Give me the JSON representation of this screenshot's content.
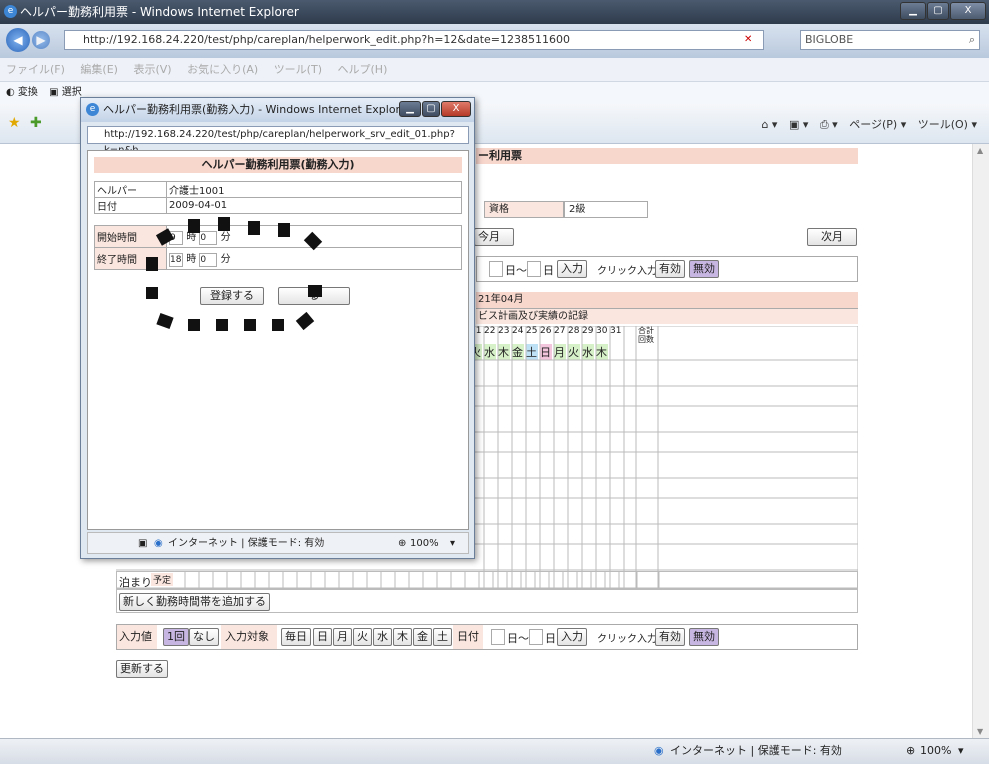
{
  "window": {
    "title": "ヘルパー勤務利用票 - Windows Internet Explorer",
    "min": "▁",
    "max": "▢",
    "close": "X"
  },
  "browser": {
    "address": "http://192.168.24.220/test/php/careplan/helperwork_edit.php?h=12&date=1238511600",
    "search_provider": "BIGLOBE",
    "back": "◀",
    "forward": "▶"
  },
  "menu": [
    "ファイル(F)",
    "編集(E)",
    "表示(V)",
    "お気に入り(A)",
    "ツール(T)",
    "ヘルプ(H)"
  ],
  "favbar": {
    "convert": "変換",
    "select": "選択"
  },
  "cmdbar": {
    "home": "⌂",
    "feeds": "▣",
    "print": "⎙",
    "page": "ページ(P)",
    "tools": "ツール(O)"
  },
  "main": {
    "header": "ー利用票",
    "qualification_label": "資格",
    "qualification_value": "2級",
    "this_month": "今月",
    "next_month": "次月",
    "day_suffix1": "日～",
    "day_suffix2": "日",
    "input_btn": "入力",
    "click_input": "クリック入力",
    "valid": "有効",
    "invalid": "無効",
    "year_month": "21年04月",
    "plan_record": "ビス計画及び実績の記録",
    "days": [
      "21",
      "22",
      "23",
      "24",
      "25",
      "26",
      "27",
      "28",
      "29",
      "30",
      "31"
    ],
    "weekdays": [
      "火",
      "水",
      "木",
      "金",
      "土",
      "日",
      "月",
      "火",
      "水",
      "木",
      ""
    ],
    "total_label": "合計回数",
    "stay_label": "泊まり",
    "plan_label": "予定",
    "add_row_btn": "新しく勤務時間帯を追加する",
    "input_value_label": "入力値",
    "once": "1回",
    "none": "なし",
    "input_target": "入力対象",
    "everyday": "毎日",
    "wd": [
      "日",
      "月",
      "火",
      "水",
      "木",
      "金",
      "土"
    ],
    "date_label": "日付",
    "update_btn": "更新する"
  },
  "popup": {
    "title": "ヘルパー勤務利用票(勤務入力) - Windows Internet Explorer",
    "address": "http://192.168.24.220/test/php/careplan/helperwork_srv_edit_01.php?k=n&h",
    "header": "ヘルパー勤務利用票(勤務入力)",
    "helper_label": "ヘルパー",
    "helper_value": "介護士1001",
    "date_label": "日付",
    "date_value": "2009-04-01",
    "start_label": "開始時間",
    "start_hour": "9",
    "start_min": "0",
    "end_label": "終了時間",
    "end_hour": "18",
    "end_min": "0",
    "hour_unit": "時",
    "min_unit": "分",
    "register_btn": "登録する",
    "close_btn": "る",
    "status": "インターネット | 保護モード: 有効",
    "zoom": "100%"
  },
  "status": {
    "zone": "インターネット | 保護モード: 有効",
    "zoom": "100%"
  }
}
